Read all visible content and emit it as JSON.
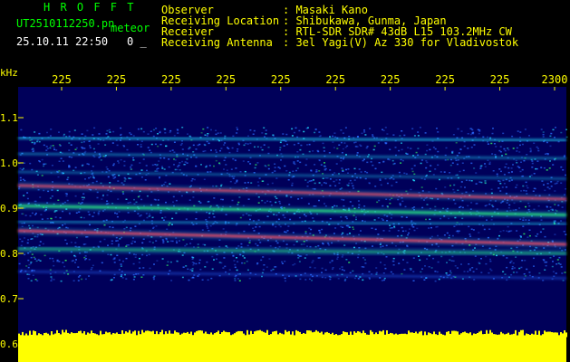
{
  "header": {
    "app_title": "H R O F F T",
    "filename": "UT2510112250.pn",
    "filename_suffix": "meteor",
    "timestamp": "25.10.11 22:50",
    "counter": "0 _"
  },
  "info": {
    "labels": [
      "Observer",
      "Receiving Location",
      "Receiver",
      "Receiving Antenna"
    ],
    "values": [
      ": Masaki Kano",
      ": Shibukawa, Gunma, Japan",
      ": RTL-SDR SDR# 43dB L15 103.2MHz CW",
      ": 3el Yagi(V) Az 330 for Vladivostok"
    ]
  },
  "colors": {
    "text_yellow": "#ffff00",
    "text_green": "#00ff00",
    "text_white": "#ffffff",
    "background_plot": "#00005a",
    "echo_blue": "#2a6bff",
    "echo_cyan": "#22e0ff",
    "echo_green": "#33ff66",
    "echo_red": "#ff2a4a",
    "noise_yellow": "#ffff00"
  },
  "chart_data": {
    "type": "heatmap",
    "title": "",
    "ylabel": "kHz",
    "xlabel": "",
    "x_tick_labels": [
      "225",
      "225",
      "225",
      "225",
      "225",
      "225",
      "225",
      "225",
      "225",
      "2300"
    ],
    "y_tick_labels": [
      "1.1",
      "1.0",
      "0.9",
      "0.8",
      "0.7",
      "0.6"
    ],
    "y_tick_values": [
      1.1,
      1.0,
      0.9,
      0.8,
      0.7,
      0.6
    ],
    "ylim": [
      0.6,
      1.2
    ],
    "grid": false,
    "traces": [
      {
        "name": "",
        "color": "red",
        "y_start": 0.95,
        "y_end": 0.92,
        "intensity": 0.9
      },
      {
        "name": "",
        "color": "red",
        "y_start": 0.85,
        "y_end": 0.82,
        "intensity": 1.0
      },
      {
        "name": "",
        "color": "green",
        "y_start": 0.905,
        "y_end": 0.885,
        "intensity": 0.8
      },
      {
        "name": "",
        "color": "green",
        "y_start": 0.81,
        "y_end": 0.8,
        "intensity": 0.5
      },
      {
        "name": "",
        "color": "cyan",
        "y_start": 1.055,
        "y_end": 1.05,
        "intensity": 0.6
      },
      {
        "name": "",
        "color": "cyan",
        "y_start": 1.02,
        "y_end": 1.01,
        "intensity": 0.4
      },
      {
        "name": "",
        "color": "cyan",
        "y_start": 0.98,
        "y_end": 0.965,
        "intensity": 0.35
      },
      {
        "name": "",
        "color": "cyan",
        "y_start": 0.87,
        "y_end": 0.865,
        "intensity": 0.45
      },
      {
        "name": "",
        "color": "blue",
        "y_start": 0.76,
        "y_end": 0.745,
        "intensity": 0.4
      }
    ],
    "noise_floor_band": [
      0.6,
      0.615
    ]
  }
}
